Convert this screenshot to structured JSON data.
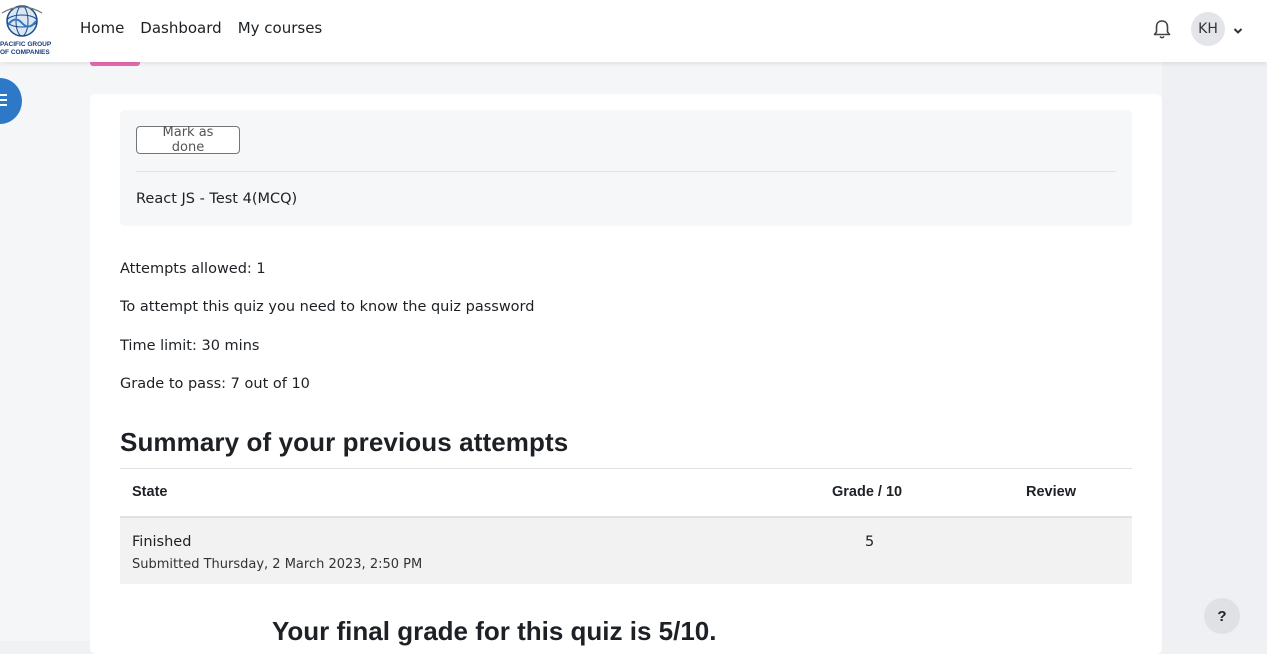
{
  "brand": {
    "logo_text_line1": "PACIFIC GROUP",
    "logo_text_line2": "OF COMPANIES"
  },
  "navbar": {
    "links": [
      "Home",
      "Dashboard",
      "My courses"
    ],
    "user_initials": "KH"
  },
  "activity": {
    "mark_done_label": "Mark as done",
    "description": "React JS - Test 4(MCQ)"
  },
  "quiz_info": {
    "attempts": "Attempts allowed: 1",
    "password_note": "To attempt this quiz you need to know the quiz password",
    "time_limit": "Time limit: 30 mins",
    "grade_to_pass": "Grade to pass: 7 out of 10"
  },
  "summary": {
    "title": "Summary of your previous attempts",
    "headers": {
      "state": "State",
      "grade": "Grade / 10",
      "review": "Review"
    },
    "rows": [
      {
        "state": "Finished",
        "submitted": "Submitted Thursday, 2 March 2023, 2:50 PM",
        "grade": "5",
        "review": ""
      }
    ]
  },
  "final_grade": "Your final grade for this quiz is 5/10.",
  "help_label": "?",
  "colors": {
    "accent": "#2d79c7",
    "badge": "#e66bb0"
  }
}
